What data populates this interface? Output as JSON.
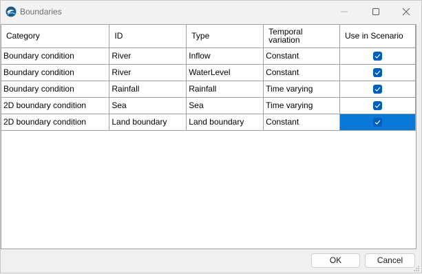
{
  "window": {
    "title": "Boundaries",
    "app_icon": "water-wave-icon"
  },
  "table": {
    "columns": [
      "Category",
      "ID",
      "Type",
      "Temporal\nvariation",
      "Use in Scenario"
    ],
    "rows": [
      {
        "category": "Boundary condition",
        "id": "River",
        "type": "Inflow",
        "temporal": "Constant",
        "use": true
      },
      {
        "category": "Boundary condition",
        "id": "River",
        "type": "WaterLevel",
        "temporal": "Constant",
        "use": true
      },
      {
        "category": "Boundary condition",
        "id": "Rainfall",
        "type": "Rainfall",
        "temporal": "Time varying",
        "use": true
      },
      {
        "category": "2D boundary condition",
        "id": "Sea",
        "type": "Sea",
        "temporal": "Time varying",
        "use": true
      },
      {
        "category": "2D boundary condition",
        "id": "Land boundary",
        "type": "Land boundary",
        "temporal": "Constant",
        "use": true
      }
    ],
    "selected_row": 4
  },
  "buttons": {
    "ok": "OK",
    "cancel": "Cancel"
  },
  "colors": {
    "checkbox": "#005fb8",
    "selection": "#0a78d7"
  }
}
